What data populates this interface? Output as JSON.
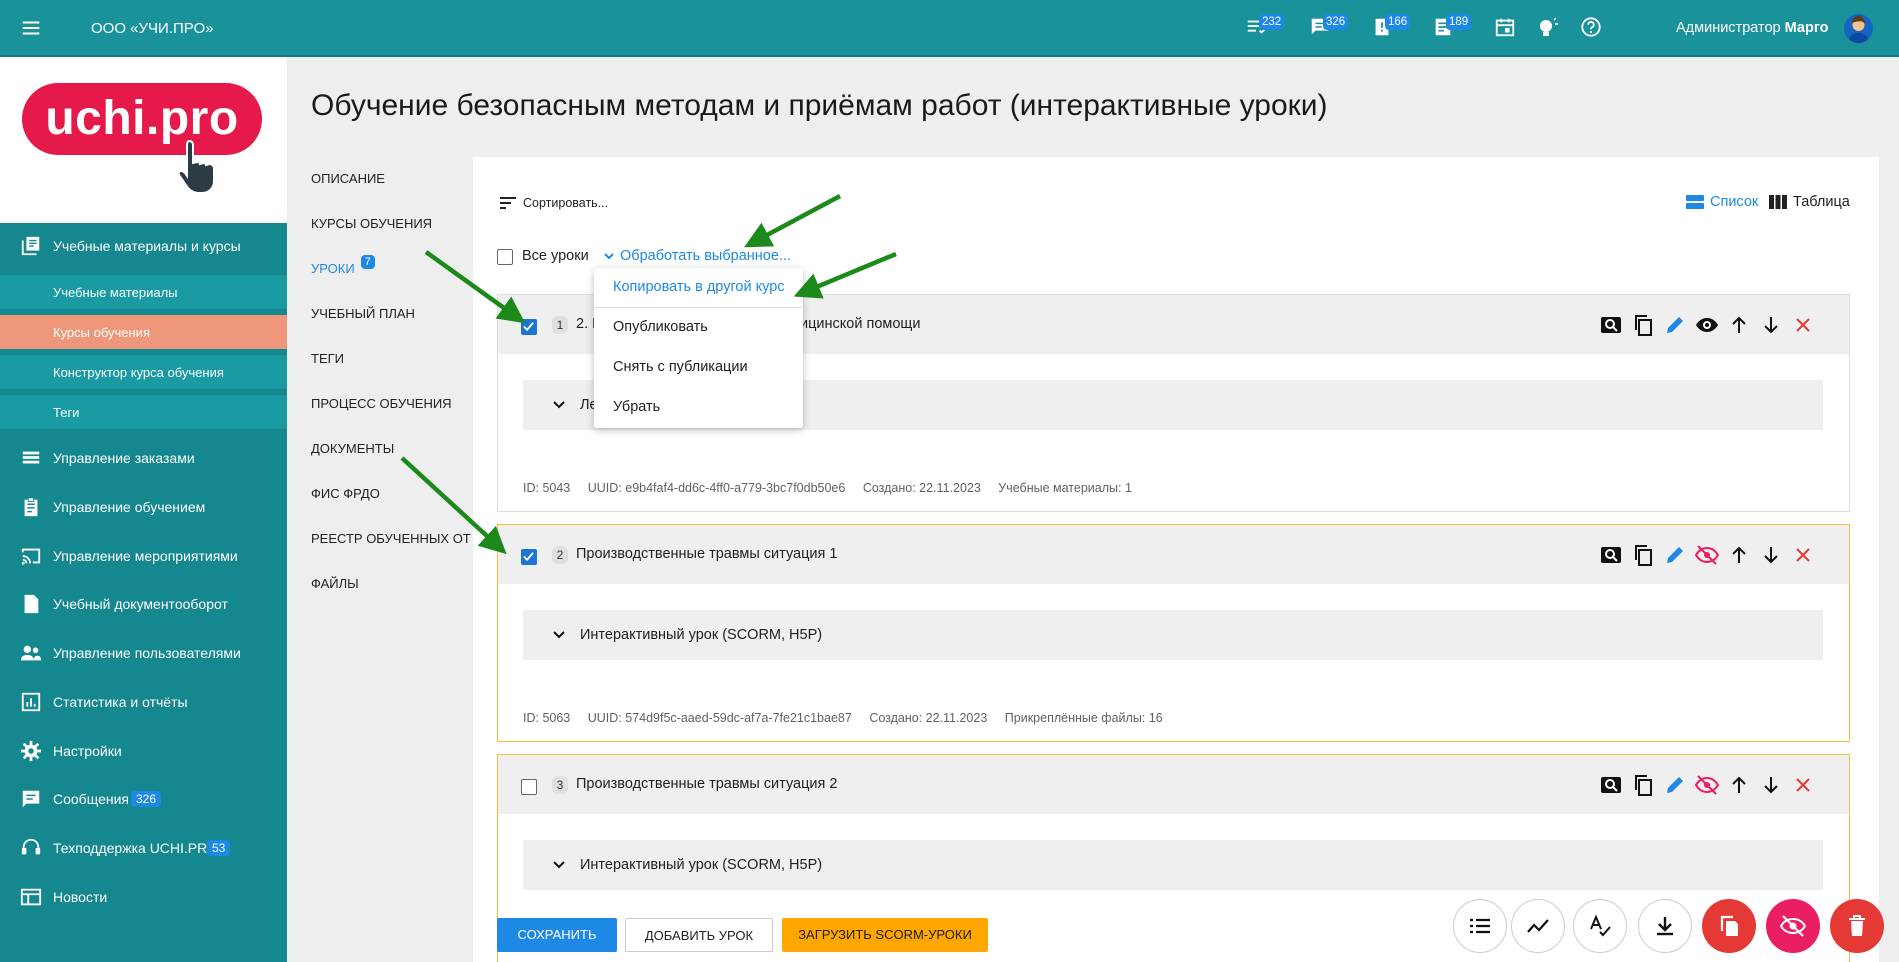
{
  "topbar": {
    "org": "ООО «УЧИ.ПРО»",
    "badges": [
      "232",
      "326",
      "166",
      "189"
    ],
    "user_role": "Администратор",
    "user_name": "Марго"
  },
  "logo": {
    "text": "uchi.pro"
  },
  "sidebar": {
    "items": [
      {
        "label": "Учебные материалы и курсы",
        "icon": "library-icon"
      },
      {
        "label": "Учебные материалы",
        "sub": true
      },
      {
        "label": "Курсы обучения",
        "sub": true,
        "active": true
      },
      {
        "label": "Конструктор курса обучения",
        "sub": true
      },
      {
        "label": "Теги",
        "sub": true
      },
      {
        "label": "Управление заказами",
        "icon": "list-icon"
      },
      {
        "label": "Управление обучением",
        "icon": "clipboard-icon"
      },
      {
        "label": "Управление мероприятиями",
        "icon": "cast-icon"
      },
      {
        "label": "Учебный документооборот",
        "icon": "document-icon"
      },
      {
        "label": "Управление пользователями",
        "icon": "people-icon"
      },
      {
        "label": "Статистика и отчёты",
        "icon": "chart-icon"
      },
      {
        "label": "Настройки",
        "icon": "gear-icon"
      },
      {
        "label": "Сообщения",
        "icon": "message-icon",
        "badge": "326"
      },
      {
        "label": "Техподдержка UCHI.PRO",
        "icon": "support-icon",
        "badge": "53"
      },
      {
        "label": "Новости",
        "icon": "news-icon"
      }
    ]
  },
  "page": {
    "title": "Обучение безопасным методам и приёмам работ (интерактивные уроки)"
  },
  "tabs": [
    {
      "label": "ОПИСАНИЕ"
    },
    {
      "label": "КУРСЫ ОБУЧЕНИЯ"
    },
    {
      "label": "УРОКИ",
      "badge": "7",
      "active": true
    },
    {
      "label": "УЧЕБНЫЙ ПЛАН"
    },
    {
      "label": "ТЕГИ"
    },
    {
      "label": "ПРОЦЕСС ОБУЧЕНИЯ"
    },
    {
      "label": "ДОКУМЕНТЫ"
    },
    {
      "label": "ФИС ФРДО"
    },
    {
      "label": "РЕЕСТР ОБУЧЕННЫХ ОТ"
    },
    {
      "label": "ФАЙЛЫ"
    }
  ],
  "toolbar": {
    "sort_label": "Сортировать...",
    "view_list": "Список",
    "view_table": "Таблица",
    "all_lessons": "Все уроки",
    "process_selected": "Обработать выбранное..."
  },
  "dropdown": {
    "items": [
      "Копировать в другой курс",
      "Опубликовать",
      "Снять с публикации",
      "Убрать"
    ]
  },
  "lessons": [
    {
      "num": "1",
      "title_start": "2. Н",
      "title_end": "ицинской помощи",
      "checked": true,
      "accordion": "Ле",
      "meta": {
        "id": "ID:  5043",
        "uuid": "UUID:  e9b4faf4-dd6c-4ff0-a779-3bc7f0db50e6",
        "created": "Создано: 22.11.2023",
        "extra": "Учебные материалы:  1"
      }
    },
    {
      "num": "2",
      "title": "Производственные травмы ситуация 1",
      "checked": true,
      "accordion": "Интерактивный урок (SCORM, H5P)",
      "meta": {
        "id": "ID:  5063",
        "uuid": "UUID:  574d9f5c-aaed-59dc-af7a-7fe21c1bae87",
        "created": "Создано: 22.11.2023",
        "extra": "Прикреплённые файлы:  16"
      }
    },
    {
      "num": "3",
      "title": "Производственные травмы ситуация 2",
      "checked": false,
      "accordion": "Интерактивный урок (SCORM, H5P)"
    }
  ],
  "buttons": {
    "save": "СОХРАНИТЬ",
    "add_lesson": "ДОБАВИТЬ УРОК",
    "upload_scorm": "ЗАГРУЗИТЬ SCORM-УРОКИ"
  },
  "colors": {
    "teal": "#19929a",
    "accent": "#1e88e5",
    "active_nav": "#ef977a",
    "logo_red": "#e5194a",
    "arrow_green": "#1b8a1b"
  }
}
